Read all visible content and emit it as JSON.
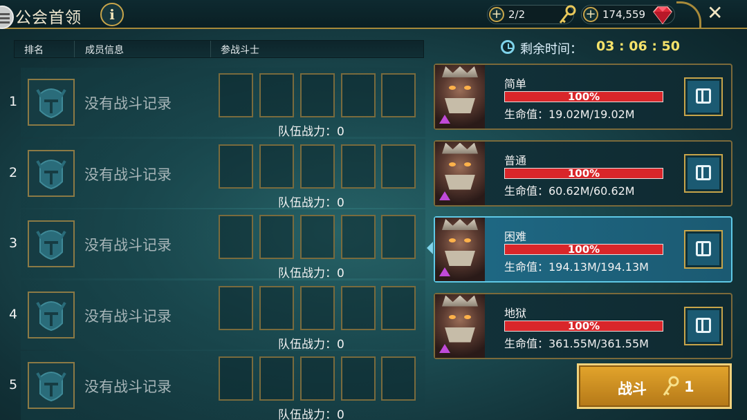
{
  "header": {
    "title": "公会首领",
    "info_glyph": "i",
    "keys": "2/2",
    "gems": "174,559",
    "close_glyph": "✕",
    "plus_glyph": "+"
  },
  "columns": {
    "rank": "排名",
    "member": "成员信息",
    "fighters": "参战斗士"
  },
  "rows": [
    {
      "rank": "1",
      "status": "没有战斗记录",
      "power": "队伍战力：0"
    },
    {
      "rank": "2",
      "status": "没有战斗记录",
      "power": "队伍战力：0"
    },
    {
      "rank": "3",
      "status": "没有战斗记录",
      "power": "队伍战力：0"
    },
    {
      "rank": "4",
      "status": "没有战斗记录",
      "power": "队伍战力：0"
    },
    {
      "rank": "5",
      "status": "没有战斗记录",
      "power": "队伍战力：0"
    }
  ],
  "timer": {
    "label": "剩余时间：",
    "value": "03 : 06 : 50"
  },
  "bosses": [
    {
      "difficulty": "简单",
      "hp_pct_text": "100%",
      "hp_fraction": 1.0,
      "hp_text": "生命值：19.02M/19.02M"
    },
    {
      "difficulty": "普通",
      "hp_pct_text": "100%",
      "hp_fraction": 1.0,
      "hp_text": "生命值：60.62M/60.62M"
    },
    {
      "difficulty": "困难",
      "hp_pct_text": "100%",
      "hp_fraction": 1.0,
      "hp_text": "生命值：194.13M/194.13M"
    },
    {
      "difficulty": "地狱",
      "hp_pct_text": "100%",
      "hp_fraction": 1.0,
      "hp_text": "生命值：361.55M/361.55M"
    }
  ],
  "selected_boss": 2,
  "fight": {
    "label": "战斗",
    "key_count": "1"
  },
  "colors": {
    "gold": "#c8a54a",
    "hp_red": "#d9262a",
    "timer_yellow": "#f5e26a",
    "selected": "#1f6a86"
  },
  "icons": [
    "menu-icon",
    "info-icon",
    "key-icon",
    "gem-icon",
    "close-icon",
    "clock-icon",
    "helmet-icon",
    "chest-icon",
    "triangle-icon"
  ]
}
